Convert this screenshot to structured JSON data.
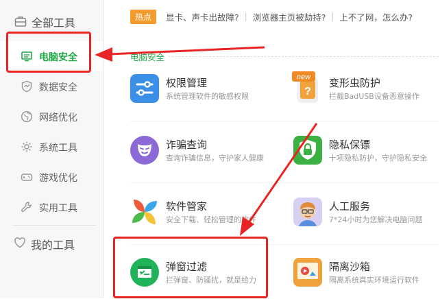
{
  "sidebar": {
    "header": {
      "label": "全部工具",
      "icon": "toolbox-icon"
    },
    "items": [
      {
        "label": "电脑安全",
        "icon": "monitor-icon",
        "active": true
      },
      {
        "label": "数据安全",
        "icon": "shield-icon",
        "active": false
      },
      {
        "label": "网络优化",
        "icon": "globe-icon",
        "active": false
      },
      {
        "label": "系统工具",
        "icon": "gear-icon",
        "active": false
      },
      {
        "label": "游戏优化",
        "icon": "gamepad-icon",
        "active": false
      },
      {
        "label": "实用工具",
        "icon": "wrench-icon",
        "active": false
      }
    ],
    "mine": {
      "label": "我的工具",
      "icon": "heart-icon"
    }
  },
  "hotbar": {
    "badge": "热点",
    "links": [
      "显卡、声卡出故障?",
      "浏览器主页被劫持?",
      "上不了网，怎么办?"
    ]
  },
  "section": {
    "title": "电脑安全"
  },
  "tools": [
    {
      "name": "权限管理",
      "desc": "系统管理软件的敏感权限",
      "icon": "sliders-icon",
      "color": "#3b8fe6"
    },
    {
      "name": "变形虫防护",
      "desc": "拦截BadUSB设备恶意操作",
      "icon": "usb-question-icon",
      "color": "#f0a23c",
      "badge": "new"
    },
    {
      "name": "诈骗查询",
      "desc": "查询诈骗信息，守护家人健康",
      "icon": "mask-icon",
      "color": "#8b6ad8"
    },
    {
      "name": "隐私保镖",
      "desc": "十项隐私防护，守护隐私安全",
      "icon": "lock-shield-icon",
      "color": "#3cb043"
    },
    {
      "name": "软件管家",
      "desc": "安全下载、轻松管理的软件",
      "icon": "pinwheel-icon",
      "color": "#f05a3c"
    },
    {
      "name": "人工服务",
      "desc": "7*24小时为您解决电脑问题",
      "icon": "agent-icon",
      "color": "#e8c29a"
    },
    {
      "name": "弹窗过滤",
      "desc": "拦弹窗、防骚扰，就是给力",
      "icon": "window-filter-icon",
      "color": "#21b35a"
    },
    {
      "name": "隔离沙箱",
      "desc": "隔离系统真实环境运行软件",
      "icon": "sandbox-icon",
      "color": "#f0a23c"
    }
  ],
  "colors": {
    "accent": "#20a845",
    "highlight": "#e82424",
    "hot": "#f59b2c"
  }
}
